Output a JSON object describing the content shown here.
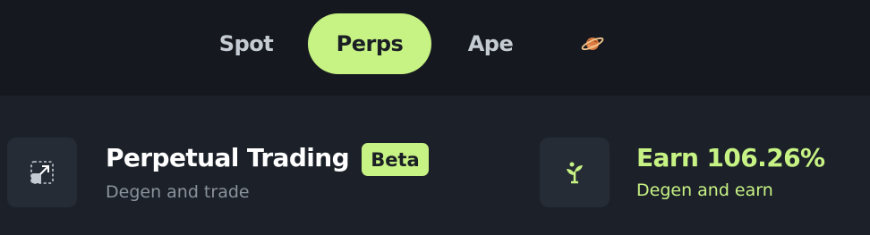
{
  "nav": {
    "tabs": [
      {
        "label": "Spot",
        "active": false
      },
      {
        "label": "Perps",
        "active": true
      },
      {
        "label": "Ape",
        "active": false
      }
    ],
    "extra_icon": "planet-icon"
  },
  "cards": {
    "perpetual": {
      "icon": "expand-arrows-icon",
      "title": "Perpetual Trading",
      "badge": "Beta",
      "subtitle": "Degen and trade"
    },
    "earn": {
      "icon": "plant-icon",
      "title": "Earn 106.26%",
      "subtitle": "Degen and earn"
    }
  },
  "colors": {
    "accent": "#c7f284",
    "top_bar": "#15191f",
    "background": "#1c2129",
    "icon_box": "#262c35",
    "muted_text": "#8a929c"
  }
}
